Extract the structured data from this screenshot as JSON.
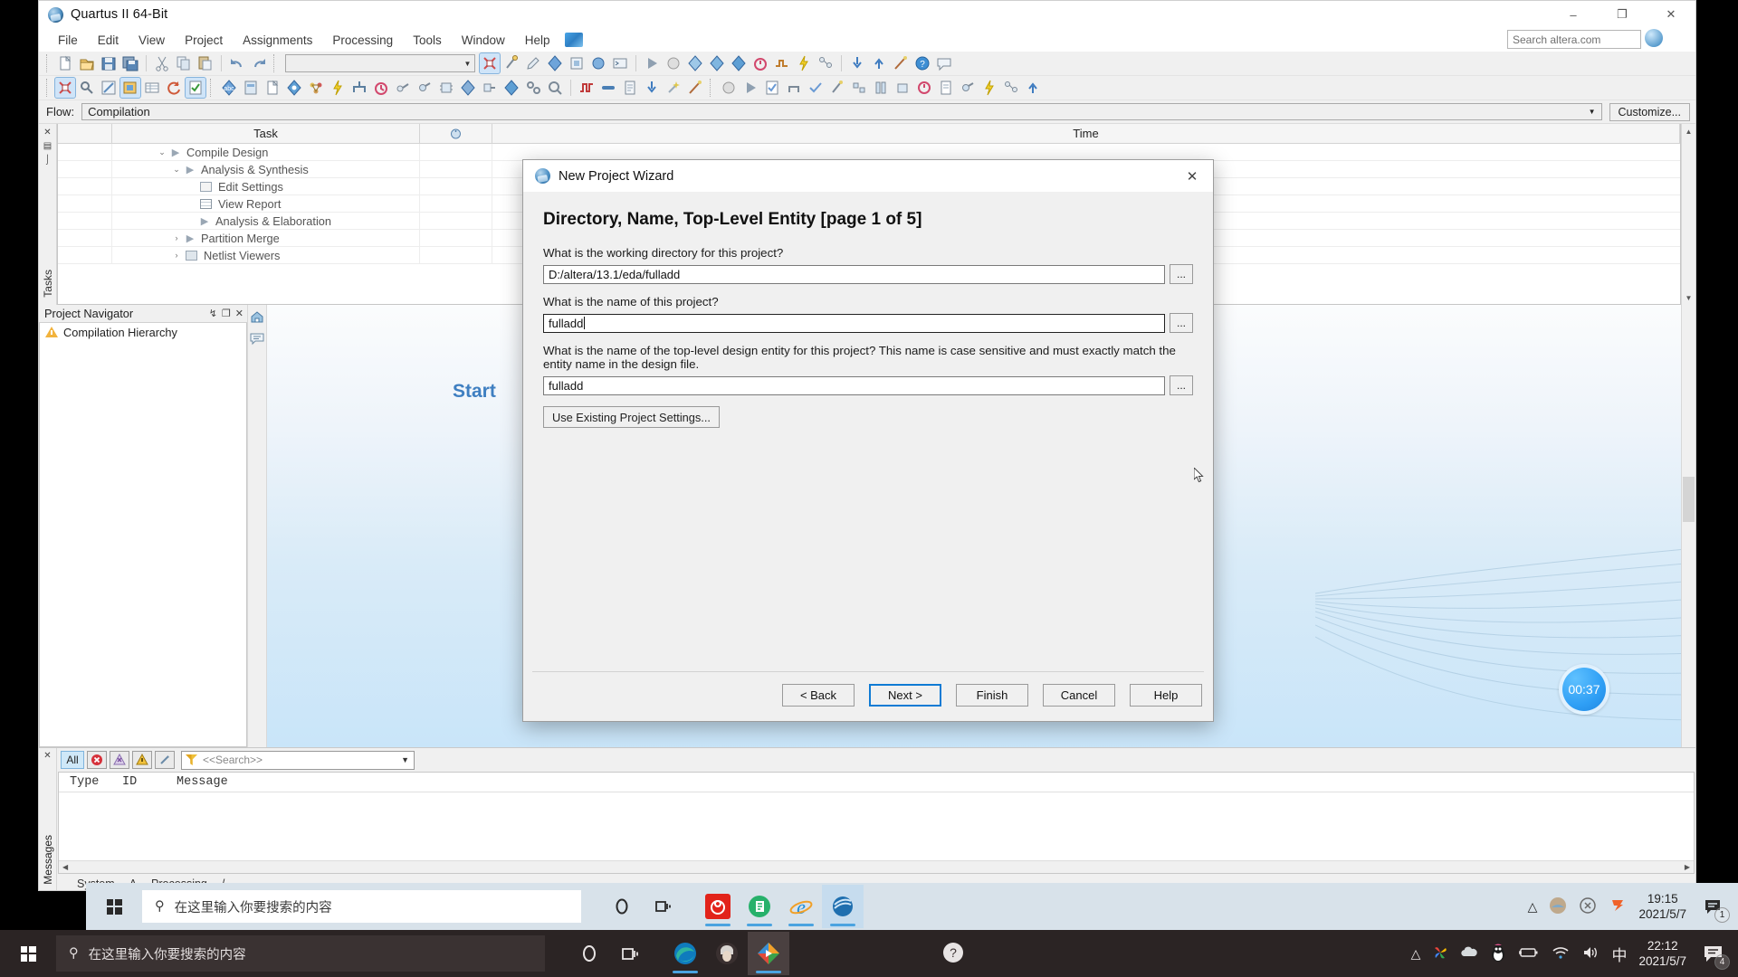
{
  "window": {
    "title": "Quartus II 64-Bit",
    "minimize": "–",
    "maximize": "❐",
    "close": "✕",
    "search_placeholder": "Search altera.com"
  },
  "menubar": {
    "items": [
      "File",
      "Edit",
      "View",
      "Project",
      "Assignments",
      "Processing",
      "Tools",
      "Window",
      "Help"
    ]
  },
  "flowbar": {
    "label": "Flow:",
    "value": "Compilation",
    "customize": "Customize..."
  },
  "tasks": {
    "headers": [
      "",
      "Task",
      "",
      "Time"
    ],
    "rows": [
      {
        "label": "Compile Design",
        "indent": 0,
        "chev": "⌄",
        "icon": "play"
      },
      {
        "label": "Analysis & Synthesis",
        "indent": 1,
        "chev": "⌄",
        "icon": "play"
      },
      {
        "label": "Edit Settings",
        "indent": 2,
        "chev": "",
        "icon": "square"
      },
      {
        "label": "View Report",
        "indent": 2,
        "chev": "",
        "icon": "grid"
      },
      {
        "label": "Analysis & Elaboration",
        "indent": 2,
        "chev": "",
        "icon": "play"
      },
      {
        "label": "Partition Merge",
        "indent": 1,
        "chev": "›",
        "icon": "play"
      },
      {
        "label": "Netlist Viewers",
        "indent": 1,
        "chev": "›",
        "icon": "folder"
      }
    ]
  },
  "tasks_vtab": {
    "label": "Tasks"
  },
  "project_navigator": {
    "title": "Project Navigator",
    "pin": "↯",
    "restore": "❐",
    "close": "✕",
    "item": "Compilation Hierarchy"
  },
  "canvas": {
    "start_text": "Start",
    "timer": "00:37"
  },
  "messages": {
    "vtab": "Messages",
    "close": "✕",
    "filters": [
      "All",
      "error-icon",
      "critical-warning-icon",
      "warning-icon",
      "info-icon"
    ],
    "filter_all_label": "All",
    "search_placeholder": "<<Search>>",
    "columns": [
      "Type",
      "ID",
      "Message"
    ],
    "tabs": [
      "System",
      "Processing"
    ],
    "tab_separator": "Λ"
  },
  "dialog": {
    "title": "New Project Wizard",
    "close": "✕",
    "heading": "Directory, Name, Top-Level Entity [page 1 of 5]",
    "q_directory": "What is the working directory for this project?",
    "v_directory": "D:/altera/13.1/eda/fulladd",
    "q_name": "What is the name of this project?",
    "v_name": "fulladd",
    "q_entity": "What is the name of the top-level design entity for this project? This name is case sensitive and must exactly match the entity name in the design file.",
    "v_entity": "fulladd",
    "browse": "...",
    "use_existing": "Use Existing Project Settings...",
    "buttons": [
      "< Back",
      "Next >",
      "Finish",
      "Cancel",
      "Help"
    ],
    "default_button": "Next >"
  },
  "taskbar_top": {
    "search_placeholder": "在这里输入你要搜索的内容",
    "cortana": "cortana-icon",
    "taskview": "task-view-icon",
    "apps": [
      "netease-music-icon",
      "wps-icon",
      "internet-explorer-icon",
      "quartus-icon"
    ],
    "tray_icons": [
      "chevron-up-icon",
      "app-tray-icon",
      "close-circle-icon",
      "sogou-icon"
    ],
    "time": "19:15",
    "date": "2021/5/7",
    "notifications": "1"
  },
  "taskbar_bottom": {
    "search_placeholder": "在这里输入你要搜索的内容",
    "cortana": "cortana-icon",
    "taskview": "task-view-icon",
    "apps": [
      "edge-icon",
      "user-avatar-icon",
      "media-player-icon"
    ],
    "tray_icons": [
      "photos-icon",
      "onedrive-icon",
      "qq-penguin-icon",
      "battery-icon",
      "wifi-icon",
      "volume-icon"
    ],
    "ime": "中",
    "time": "22:12",
    "date": "2021/5/7",
    "notifications": "4"
  },
  "colors": {
    "accent_blue": "#0f7bd4",
    "start_text": "#3f7fc1",
    "selection": "#cfe4f8",
    "taskbar_light": "#d8e2ea",
    "taskbar_dark": "#2b2424"
  }
}
